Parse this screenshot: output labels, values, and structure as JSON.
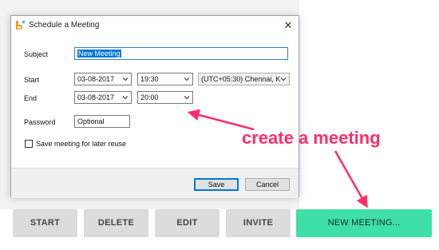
{
  "dialog": {
    "title": "Schedule a Meeting",
    "close_glyph": "✕",
    "subject_label": "Subject",
    "subject_value": "New Meeting",
    "start_label": "Start",
    "start_date": "03-08-2017",
    "start_time": "19:30",
    "timezone": "(UTC+05:30) Chennai, K",
    "end_label": "End",
    "end_date": "03-08-2017",
    "end_time": "20:00",
    "password_label": "Password",
    "password_value": "Optional",
    "save_checkbox_label": "Save meeting for later reuse",
    "save_checked": false,
    "save_button": "Save",
    "cancel_button": "Cancel"
  },
  "actions": {
    "start": "START",
    "delete": "DELETE",
    "edit": "EDIT",
    "invite": "INVITE",
    "new_meeting": "NEW MEETING..."
  },
  "annotation": {
    "text": "create a meeting",
    "color": "#ff2d6b"
  },
  "colors": {
    "accent_green": "#3fdfa8",
    "selection_blue": "#0078d7",
    "button_gray": "#dcdcdc"
  },
  "icons": {
    "app": "app-logo-icon",
    "close": "close-icon",
    "dropdown": "chevron-down-icon"
  }
}
